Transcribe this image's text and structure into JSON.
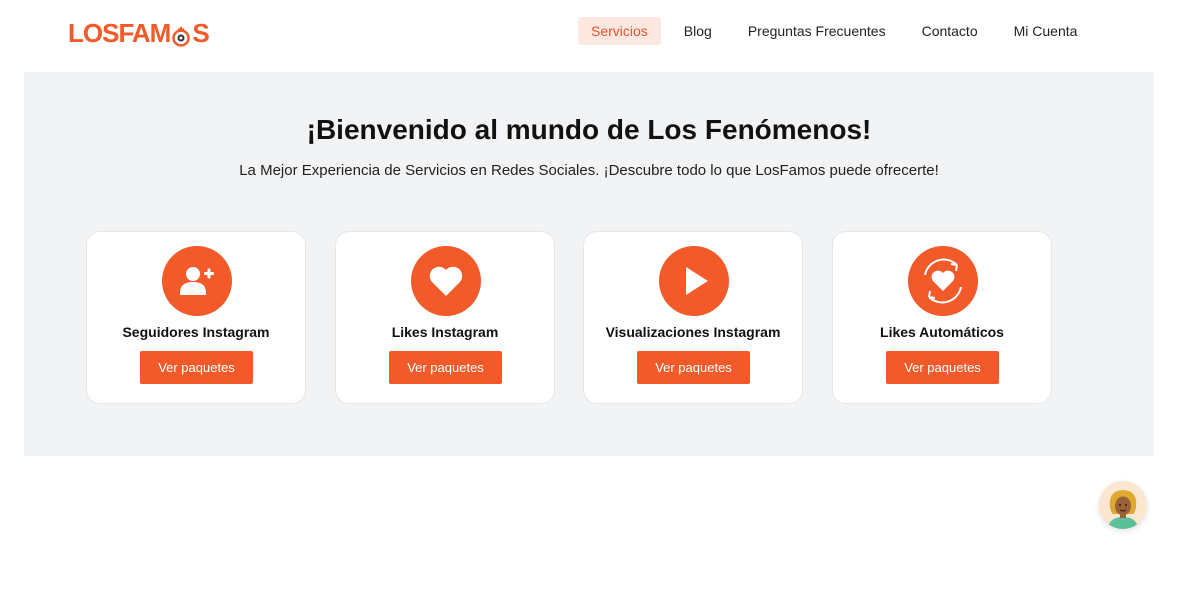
{
  "logo": {
    "text_left": "LOSFAM",
    "text_right": "S"
  },
  "nav": {
    "items": [
      {
        "label": "Servicios",
        "active": true
      },
      {
        "label": "Blog"
      },
      {
        "label": "Preguntas Frecuentes"
      },
      {
        "label": "Contacto"
      },
      {
        "label": "Mi Cuenta"
      }
    ]
  },
  "hero": {
    "title": "¡Bienvenido al mundo de Los Fenómenos!",
    "subtitle": "La Mejor Experiencia de Servicios en Redes Sociales. ¡Descubre todo lo que LosFamos puede ofrecerte!"
  },
  "services": [
    {
      "title": "Seguidores Instagram",
      "button": "Ver paquetes",
      "icon": "add-user-icon"
    },
    {
      "title": "Likes Instagram",
      "button": "Ver paquetes",
      "icon": "heart-icon"
    },
    {
      "title": "Visualizaciones Instagram",
      "button": "Ver paquetes",
      "icon": "play-icon"
    },
    {
      "title": "Likes Automáticos",
      "button": "Ver paquetes",
      "icon": "auto-heart-icon"
    }
  ],
  "colors": {
    "accent": "#f25a29",
    "hero_bg": "#f2f3f5",
    "active_nav_bg": "#fde7e1"
  },
  "chat": {
    "icon": "assistant-avatar-icon"
  }
}
